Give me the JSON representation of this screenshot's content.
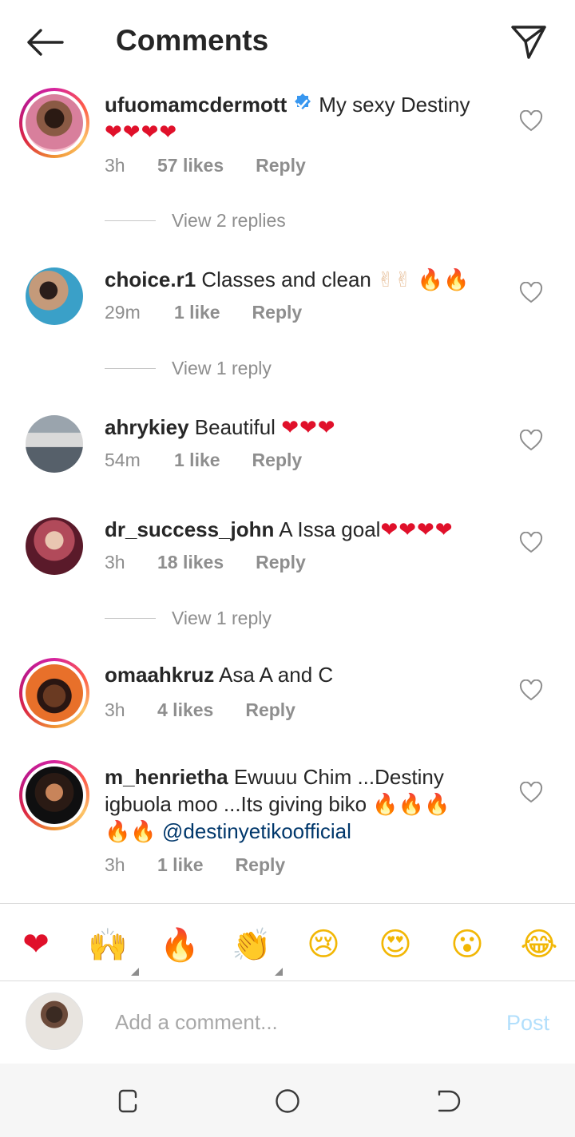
{
  "header": {
    "title": "Comments",
    "back_icon": "arrow-left-icon",
    "send_icon": "paper-plane-icon"
  },
  "colors": {
    "text": "#262626",
    "secondary": "#8e8e8e",
    "heart": "#e0102a",
    "verified": "#3897f0",
    "link": "#00376b",
    "post_disabled": "#b2dffc"
  },
  "comments": [
    {
      "username": "ufuomamcdermott",
      "verified": true,
      "text": "My sexy Destiny",
      "emoji_line": "❤❤❤❤",
      "time": "3h",
      "likes": "57 likes",
      "reply": "Reply",
      "view_replies": "View 2 replies"
    },
    {
      "username": "choice.r1",
      "text": "Classes and clean",
      "emoji_line_a": "✌✌",
      "emoji_line_b": "🔥🔥",
      "time": "29m",
      "likes": "1 like",
      "reply": "Reply",
      "view_replies": "View 1 reply"
    },
    {
      "username": "ahrykiey",
      "text": "Beautiful",
      "emoji_line": "❤❤❤",
      "time": "54m",
      "likes": "1 like",
      "reply": "Reply"
    },
    {
      "username": "dr_success_john",
      "text": "A Issa goal",
      "emoji_line": "❤❤❤❤",
      "time": "3h",
      "likes": "18 likes",
      "reply": "Reply",
      "view_replies": "View 1 reply"
    },
    {
      "username": "omaahkruz",
      "text": "Asa A and C",
      "time": "3h",
      "likes": "4 likes",
      "reply": "Reply"
    },
    {
      "username": "m_henrietha",
      "text": "Ewuuu Chim ...Destiny igbuola moo ...Its giving biko",
      "emoji_line_a": "🔥🔥🔥",
      "emoji_line_b": "🔥🔥",
      "mention": "@destinyetikoofficial",
      "time": "3h",
      "likes": "1 like",
      "reply": "Reply"
    }
  ],
  "emoji_bar": [
    {
      "name": "red-heart",
      "glyph": "❤"
    },
    {
      "name": "raising-hands",
      "glyph": "🙌"
    },
    {
      "name": "fire",
      "glyph": "🔥"
    },
    {
      "name": "clapping-hands",
      "glyph": "👏"
    },
    {
      "name": "crying-face",
      "glyph": "😢"
    },
    {
      "name": "heart-eyes",
      "glyph": "😍"
    },
    {
      "name": "open-mouth",
      "glyph": "😮"
    },
    {
      "name": "tears-of-joy",
      "glyph": "😂"
    }
  ],
  "input": {
    "placeholder": "Add a comment...",
    "post_label": "Post"
  },
  "system_nav": [
    "recent-apps-icon",
    "home-icon",
    "back-icon"
  ]
}
